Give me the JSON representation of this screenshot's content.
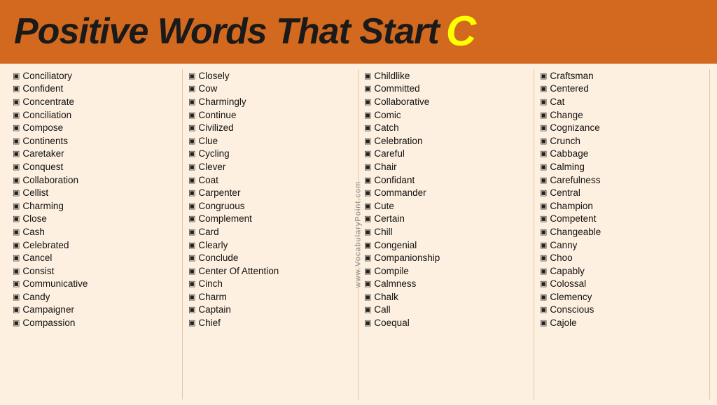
{
  "header": {
    "title": "Positive Words That Start",
    "letter": "C",
    "background": "#d2691e"
  },
  "watermark": "www.VocabularyPoint.com",
  "columns": [
    {
      "words": [
        "Conciliatory",
        "Confident",
        "Concentrate",
        "Conciliation",
        "Compose",
        "Continents",
        "Caretaker",
        "Conquest",
        "Collaboration",
        "Cellist",
        "Charming",
        "Close",
        "Cash",
        "Celebrated",
        "Cancel",
        "Consist",
        "Communicative",
        "Candy",
        "Campaigner",
        "Compassion"
      ]
    },
    {
      "words": [
        "Closely",
        "Cow",
        "Charmingly",
        "Continue",
        "Civilized",
        "Clue",
        "Cycling",
        "Clever",
        "Coat",
        "Carpenter",
        "Congruous",
        "Complement",
        "Card",
        "Clearly",
        "Conclude",
        "Center Of Attention",
        "Cinch",
        "Charm",
        "Captain",
        "Chief"
      ]
    },
    {
      "words": [
        "Childlike",
        "Committed",
        "Collaborative",
        "Comic",
        "Catch",
        "Celebration",
        "Careful",
        "Chair",
        "Confidant",
        "Commander",
        "Cute",
        "Certain",
        "Chill",
        "Congenial",
        "Companionship",
        "Compile",
        "Calmness",
        "Chalk",
        "Call",
        "Coequal"
      ]
    },
    {
      "words": [
        "Craftsman",
        "Centered",
        "Cat",
        "Change",
        "Cognizance",
        "Crunch",
        "Cabbage",
        "Calming",
        "Carefulness",
        "Central",
        "Champion",
        "Competent",
        "Changeable",
        "Canny",
        "Choo",
        "Capably",
        "Colossal",
        "Clemency",
        "Conscious",
        "Cajole"
      ]
    }
  ]
}
